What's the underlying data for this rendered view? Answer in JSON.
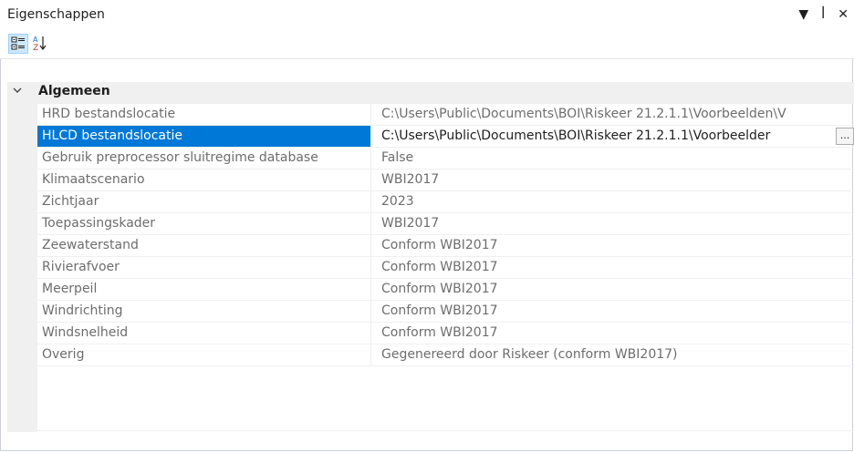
{
  "window": {
    "title": "Eigenschappen",
    "controls": [
      "▼",
      "ꟾ",
      "✕"
    ]
  },
  "toolbar": {
    "buttons": [
      {
        "icon": "categorized-icon"
      },
      {
        "icon": "sort-az-icon"
      }
    ]
  },
  "category": {
    "label": "Algemeen",
    "expanded": true
  },
  "properties": [
    {
      "name": "HRD bestandslocatie",
      "value": "C:\\Users\\Public\\Documents\\BOI\\Riskeer 21.2.1.1\\Voorbeelden\\V"
    },
    {
      "name": "HLCD bestandslocatie",
      "value": "C:\\Users\\Public\\Documents\\BOI\\Riskeer 21.2.1.1\\Voorbeelder",
      "selected": true,
      "button": "..."
    },
    {
      "name": "Gebruik preprocessor sluitregime database",
      "value": "False"
    },
    {
      "name": "Klimaatscenario",
      "value": "WBI2017"
    },
    {
      "name": "Zichtjaar",
      "value": "2023"
    },
    {
      "name": "Toepassingskader",
      "value": "WBI2017"
    },
    {
      "name": "Zeewaterstand",
      "value": "Conform WBI2017"
    },
    {
      "name": "Rivierafvoer",
      "value": "Conform WBI2017"
    },
    {
      "name": "Meerpeil",
      "value": "Conform WBI2017"
    },
    {
      "name": "Windrichting",
      "value": "Conform WBI2017"
    },
    {
      "name": "Windsnelheid",
      "value": "Conform WBI2017"
    },
    {
      "name": "Overig",
      "value": "Gegenereerd door Riskeer (conform WBI2017)"
    }
  ],
  "colors": {
    "selection": "#0078d7",
    "gutter": "#f0f0f0",
    "category_bg": "#f0f0f0"
  }
}
